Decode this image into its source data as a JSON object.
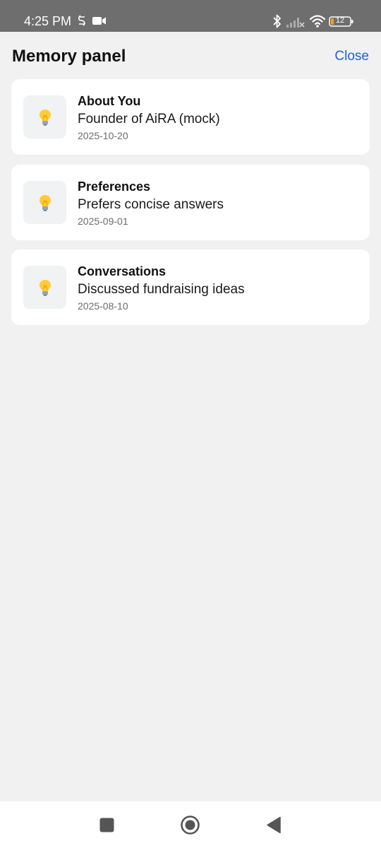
{
  "status_bar": {
    "time": "4:25 PM",
    "battery_level": "12",
    "icons": [
      "sync-icon",
      "video-camera-icon",
      "bluetooth-icon",
      "cellular-signal-icon",
      "wifi-icon",
      "battery-icon"
    ]
  },
  "header": {
    "title": "Memory panel",
    "close_label": "Close"
  },
  "memories": [
    {
      "icon": "lightbulb-icon",
      "title": "About You",
      "text": "Founder of AiRA (mock)",
      "date": "2025-10-20"
    },
    {
      "icon": "lightbulb-icon",
      "title": "Preferences",
      "text": "Prefers concise answers",
      "date": "2025-09-01"
    },
    {
      "icon": "lightbulb-icon",
      "title": "Conversations",
      "text": "Discussed fundraising ideas",
      "date": "2025-08-10"
    }
  ],
  "nav_bar": {
    "buttons": [
      "recents-button",
      "home-button",
      "back-button"
    ]
  },
  "colors": {
    "status_bar": "#6e6e6e",
    "background": "#f1f1f1",
    "card": "#ffffff",
    "accent": "#1f62c8",
    "icon_box": "#f1f2f4"
  }
}
